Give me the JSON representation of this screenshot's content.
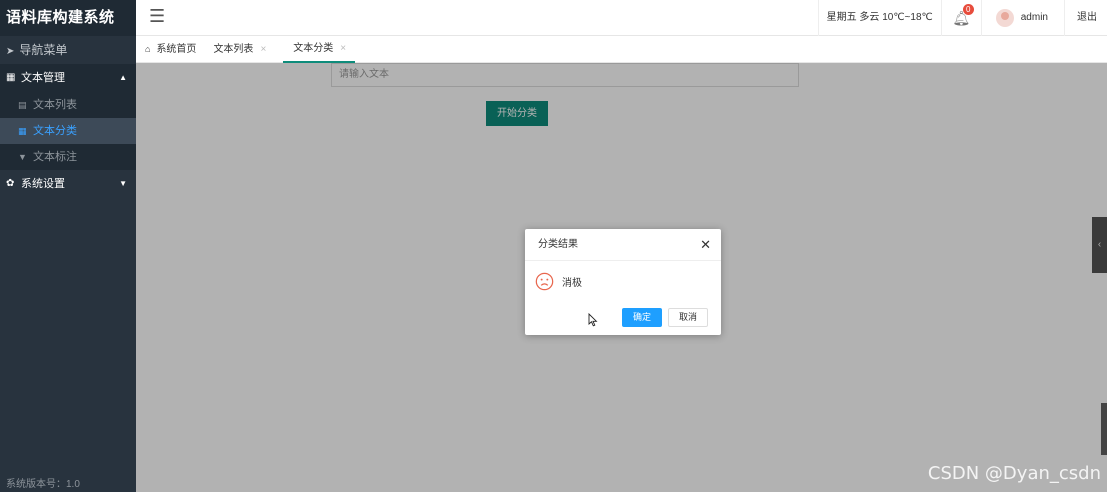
{
  "app": {
    "title": "语料库构建系统",
    "version": "系统版本号：1.0"
  },
  "sidebar": {
    "nav_title": "导航菜单",
    "groups": [
      {
        "label": "文本管理",
        "icon": "grid-icon",
        "expanded": true,
        "items": [
          {
            "label": "文本列表",
            "icon": "list-icon",
            "active": false
          },
          {
            "label": "文本分类",
            "icon": "tiles-icon",
            "active": true
          },
          {
            "label": "文本标注",
            "icon": "filter-icon",
            "active": false
          }
        ]
      },
      {
        "label": "系统设置",
        "icon": "gear-icon",
        "expanded": false
      }
    ]
  },
  "header": {
    "weather": "星期五 多云 10℃~18℃",
    "notification_count": "0",
    "username": "admin",
    "logout": "退出"
  },
  "tabs": [
    {
      "label": "系统首页",
      "icon": "home-icon",
      "closable": false,
      "active": false
    },
    {
      "label": "文本列表",
      "closable": true,
      "active": false
    },
    {
      "label": "文本分类",
      "closable": true,
      "active": true
    }
  ],
  "main": {
    "text_input_placeholder": "请输入文本",
    "classify_button": "开始分类"
  },
  "dialog": {
    "title": "分类结果",
    "result": "消极",
    "ok": "确定",
    "cancel": "取消"
  },
  "watermark": "CSDN @Dyan_csdn",
  "colors": {
    "accent": "#0e8c7b",
    "primary_button": "#1e9fff",
    "sidebar_bg": "#28333e",
    "active_link": "#3aa1ff",
    "sad_icon": "#e8674e"
  }
}
